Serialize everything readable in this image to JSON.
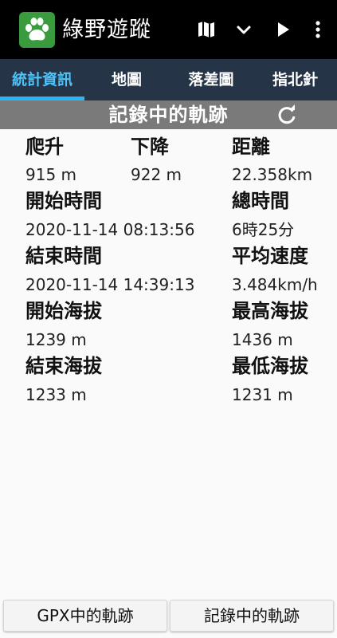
{
  "app": {
    "title": "綠野遊蹤",
    "logo_icon": "paw-icon",
    "actions": [
      {
        "icon": "map-icon"
      },
      {
        "icon": "chevron-down-icon"
      },
      {
        "icon": "play-icon"
      },
      {
        "icon": "more-vert-icon"
      }
    ]
  },
  "tabs": [
    {
      "label": "統計資訊",
      "active": true
    },
    {
      "label": "地圖",
      "active": false
    },
    {
      "label": "落差圖",
      "active": false
    },
    {
      "label": "指北針",
      "active": false
    }
  ],
  "panel": {
    "title": "記錄中的軌跡",
    "refresh_icon": "refresh-icon"
  },
  "stats": {
    "climb": {
      "label": "爬升",
      "value": "915 m"
    },
    "descent": {
      "label": "下降",
      "value": "922 m"
    },
    "distance": {
      "label": "距離",
      "value": "22.358km"
    },
    "start_time": {
      "label": "開始時間",
      "value": "2020-11-14 08:13:56"
    },
    "total_time": {
      "label": "總時間",
      "value": "6時25分"
    },
    "end_time": {
      "label": "結束時間",
      "value": "2020-11-14 14:39:13"
    },
    "avg_speed": {
      "label": "平均速度",
      "value": "3.484km/h"
    },
    "start_elev": {
      "label": "開始海拔",
      "value": "1239 m"
    },
    "max_elev": {
      "label": "最高海拔",
      "value": "1436 m"
    },
    "end_elev": {
      "label": "結束海拔",
      "value": "1233 m"
    },
    "min_elev": {
      "label": "最低海拔",
      "value": "1231 m"
    }
  },
  "bottom": {
    "gpx_label": "GPX中的軌跡",
    "recording_label": "記錄中的軌跡"
  },
  "colors": {
    "appbar": "#000000",
    "tabbar": "#253447",
    "tab_active": "#4fc3f7",
    "titlebar": "#7a7a7a",
    "logo": "#3a9a3e"
  }
}
